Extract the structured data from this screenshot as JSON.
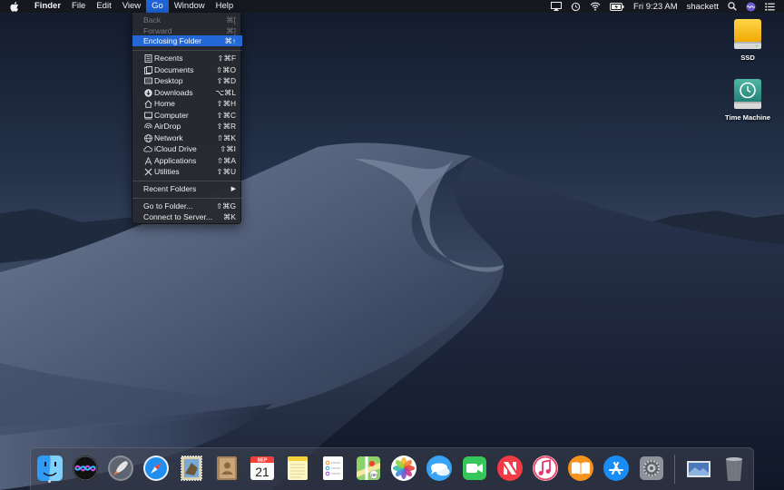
{
  "menubar": {
    "apple": "apple-logo",
    "menus": [
      "Finder",
      "File",
      "Edit",
      "View",
      "Go",
      "Window",
      "Help"
    ],
    "active_menu": "Go",
    "status": {
      "clock": "Fri 9:23 AM",
      "user": "shackett"
    }
  },
  "go_menu": {
    "items": [
      {
        "label": "Back",
        "shortcut": "⌘[",
        "enabled": false
      },
      {
        "label": "Forward",
        "shortcut": "⌘]",
        "enabled": false
      },
      {
        "label": "Enclosing Folder",
        "shortcut": "⌘↑",
        "highlighted": true
      },
      {
        "label": "Recents",
        "shortcut": "⇧⌘F",
        "icon": "recents-icon"
      },
      {
        "label": "Documents",
        "shortcut": "⇧⌘O",
        "icon": "documents-icon"
      },
      {
        "label": "Desktop",
        "shortcut": "⇧⌘D",
        "icon": "desktop-icon"
      },
      {
        "label": "Downloads",
        "shortcut": "⌥⌘L",
        "icon": "downloads-icon"
      },
      {
        "label": "Home",
        "shortcut": "⇧⌘H",
        "icon": "home-icon"
      },
      {
        "label": "Computer",
        "shortcut": "⇧⌘C",
        "icon": "computer-icon"
      },
      {
        "label": "AirDrop",
        "shortcut": "⇧⌘R",
        "icon": "airdrop-icon"
      },
      {
        "label": "Network",
        "shortcut": "⇧⌘K",
        "icon": "network-icon"
      },
      {
        "label": "iCloud Drive",
        "shortcut": "⇧⌘I",
        "icon": "icloud-icon"
      },
      {
        "label": "Applications",
        "shortcut": "⇧⌘A",
        "icon": "applications-icon"
      },
      {
        "label": "Utilities",
        "shortcut": "⇧⌘U",
        "icon": "utilities-icon"
      },
      {
        "label": "Recent Folders",
        "submenu": "▶"
      },
      {
        "label": "Go to Folder...",
        "shortcut": "⇧⌘G"
      },
      {
        "label": "Connect to Server...",
        "shortcut": "⌘K"
      }
    ]
  },
  "desktop": {
    "icons": [
      {
        "label": "SSD",
        "icon": "external-drive-icon"
      },
      {
        "label": "Time Machine",
        "icon": "time-machine-drive-icon"
      }
    ]
  },
  "dock": {
    "apps": [
      "Finder",
      "Siri",
      "Launchpad",
      "Safari",
      "Mail",
      "Contacts",
      "Calendar",
      "Notes",
      "Reminders",
      "Maps",
      "Photos",
      "Messages",
      "FaceTime",
      "News",
      "iTunes",
      "Books",
      "App Store",
      "System Preferences"
    ],
    "calendar_month": "SEP",
    "calendar_day": "21",
    "right_items": [
      "Downloads stack",
      "Trash"
    ]
  },
  "colors": {
    "menu_highlight": "#2468d8",
    "menubar_bg": "#16181e"
  }
}
